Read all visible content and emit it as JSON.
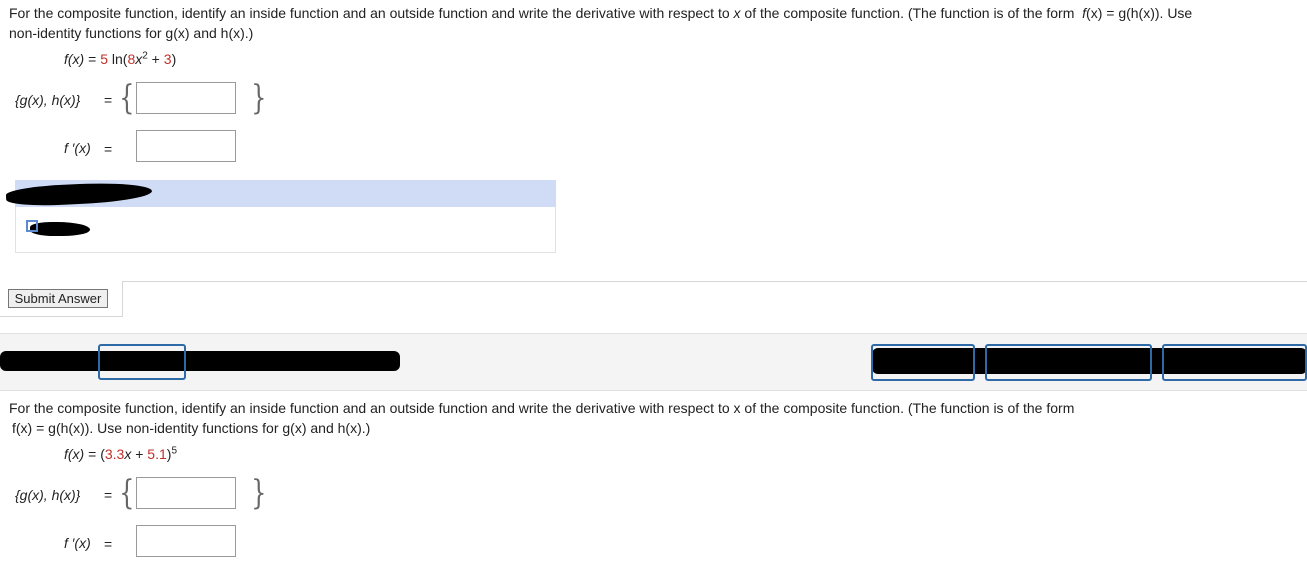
{
  "q1": {
    "prompt_line1_a": "For the composite function, identify an inside function and an outside function and write the derivative with respect to ",
    "var_x": "x",
    "prompt_line1_b": " of the composite function. (The function is of the form ",
    "form_f": "f",
    "form_rest": "(x) = g(h(x)).  Use",
    "prompt_line2": "non-identity functions for g(x) and h(x).)",
    "func_lhs": "f(x)",
    "eq": "=",
    "coef": "5",
    "ln_open": " ln(",
    "inner_a": "8",
    "inner_x": "x",
    "inner_exp": "2",
    "inner_plus": " + ",
    "inner_b": "3",
    "close": ")",
    "pair_label": "{g(x), h(x)}",
    "pair_eq": "=",
    "brace_open": "{",
    "brace_close": "}",
    "deriv_label": "f ′(x)",
    "deriv_eq": "="
  },
  "submit": {
    "label": "Submit Answer"
  },
  "q2": {
    "prompt_line1": "For the composite function, identify an inside function and an outside function and write the derivative with respect to x of the composite function. (The function is of the form",
    "prompt_line2": "f(x) = g(h(x)). Use non-identity functions for g(x) and h(x).)",
    "func_lhs": "f(x)",
    "eq": "=",
    "open": "(",
    "a": "3.3",
    "x": "x",
    "plus": " + ",
    "b": "5.1",
    "close": ")",
    "exp": "5",
    "pair_label": "{g(x), h(x)}",
    "pair_eq": "=",
    "brace_open": "{",
    "brace_close": "}",
    "deriv_label": "f ′(x)",
    "deriv_eq": "="
  },
  "colors": {
    "accent_red": "#c0302a",
    "hint_bar": "#d0dbf6",
    "button_border_blue": "#2f6aa8"
  }
}
